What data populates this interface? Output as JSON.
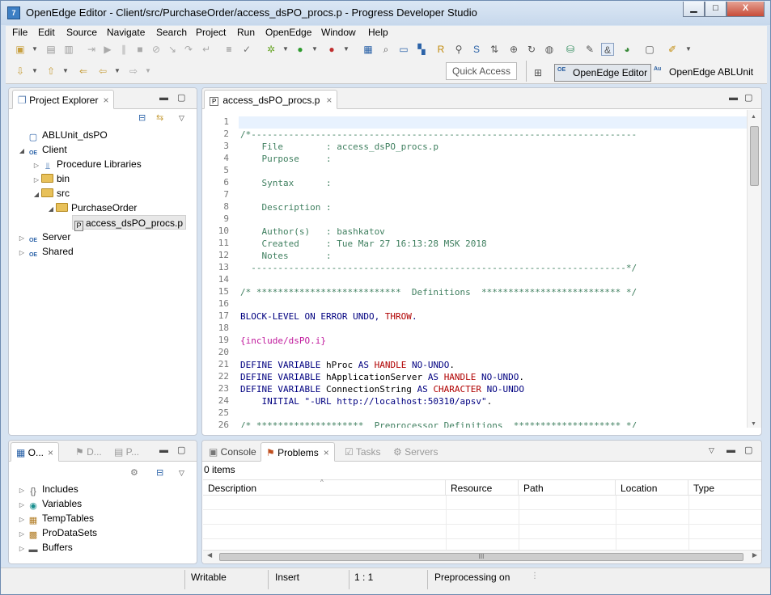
{
  "window": {
    "title": "OpenEdge Editor - Client/src/PurchaseOrder/access_dsPO_procs.p - Progress Developer Studio",
    "app_icon_text": "7",
    "minimize_label": "▁",
    "maximize_label": "□",
    "close_label": "X"
  },
  "menu": [
    "File",
    "Edit",
    "Source",
    "Navigate",
    "Search",
    "Project",
    "Run",
    "OpenEdge",
    "Window",
    "Help"
  ],
  "toolbar": {
    "quick_access_placeholder": "Quick Access",
    "perspectives": [
      {
        "label": "OpenEdge Editor",
        "icon_text": "OE",
        "active": true
      },
      {
        "label": "OpenEdge ABLUnit",
        "icon_text": "Au",
        "active": false
      }
    ]
  },
  "project_explorer": {
    "tab_label": "Project Explorer",
    "tree": [
      {
        "label": "ABLUnit_dsPO",
        "icon": "project-icon",
        "expanded": null
      },
      {
        "label": "Client",
        "icon": "oe-project-icon",
        "expanded": true
      },
      {
        "label": "Procedure Libraries",
        "icon": "library-icon",
        "expanded": false
      },
      {
        "label": "bin",
        "icon": "folder-icon",
        "expanded": false
      },
      {
        "label": "src",
        "icon": "folder-icon",
        "expanded": true
      },
      {
        "label": "PurchaseOrder",
        "icon": "folder-icon",
        "expanded": true
      },
      {
        "label": "access_dsPO_procs.p",
        "icon": "procedure-file-icon",
        "expanded": null
      },
      {
        "label": "Server",
        "icon": "oe-project-icon",
        "expanded": false
      },
      {
        "label": "Shared",
        "icon": "oe-project-icon",
        "expanded": false
      }
    ]
  },
  "editor": {
    "tab_label": "access_dsPO_procs.p",
    "tab_icon_text": "P",
    "lines": [
      {
        "n": "1",
        "parts": []
      },
      {
        "n": "2",
        "parts": [
          {
            "t": "/*------------------------------------------------------------------------",
            "c": "cmt"
          }
        ]
      },
      {
        "n": "3",
        "parts": [
          {
            "t": "    File        : access_dsPO_procs.p",
            "c": "cmt"
          }
        ]
      },
      {
        "n": "4",
        "parts": [
          {
            "t": "    Purpose     :",
            "c": "cmt"
          }
        ]
      },
      {
        "n": "5",
        "parts": []
      },
      {
        "n": "6",
        "parts": [
          {
            "t": "    Syntax      :",
            "c": "cmt"
          }
        ]
      },
      {
        "n": "7",
        "parts": []
      },
      {
        "n": "8",
        "parts": [
          {
            "t": "    Description :",
            "c": "cmt"
          }
        ]
      },
      {
        "n": "9",
        "parts": []
      },
      {
        "n": "10",
        "parts": [
          {
            "t": "    Author(s)   : bashkatov",
            "c": "cmt"
          }
        ]
      },
      {
        "n": "11",
        "parts": [
          {
            "t": "    Created     : Tue Mar 27 16:13:28 MSK 2018",
            "c": "cmt"
          }
        ]
      },
      {
        "n": "12",
        "parts": [
          {
            "t": "    Notes       :",
            "c": "cmt"
          }
        ]
      },
      {
        "n": "13",
        "parts": [
          {
            "t": "  ----------------------------------------------------------------------*/",
            "c": "cmt"
          }
        ]
      },
      {
        "n": "14",
        "parts": []
      },
      {
        "n": "15",
        "parts": [
          {
            "t": "/* ***************************  Definitions  ************************** */",
            "c": "cmt"
          }
        ]
      },
      {
        "n": "16",
        "parts": []
      },
      {
        "n": "17",
        "parts": [
          {
            "t": "BLOCK-LEVEL ON ERROR UNDO, ",
            "c": "kw"
          },
          {
            "t": "THROW",
            "c": "red"
          },
          {
            "t": ".",
            "c": "kw"
          }
        ]
      },
      {
        "n": "18",
        "parts": []
      },
      {
        "n": "19",
        "parts": [
          {
            "t": "{include/dsPO.i}",
            "c": "pp"
          }
        ]
      },
      {
        "n": "20",
        "parts": []
      },
      {
        "n": "21",
        "parts": [
          {
            "t": "DEFINE VARIABLE ",
            "c": "kw"
          },
          {
            "t": "hProc ",
            "c": ""
          },
          {
            "t": "AS ",
            "c": "kw"
          },
          {
            "t": "HANDLE ",
            "c": "red"
          },
          {
            "t": "NO-UNDO",
            "c": "kw"
          },
          {
            "t": ".",
            "c": ""
          }
        ]
      },
      {
        "n": "22",
        "parts": [
          {
            "t": "DEFINE VARIABLE ",
            "c": "kw"
          },
          {
            "t": "hApplicationServer ",
            "c": ""
          },
          {
            "t": "AS ",
            "c": "kw"
          },
          {
            "t": "HANDLE ",
            "c": "red"
          },
          {
            "t": "NO-UNDO",
            "c": "kw"
          },
          {
            "t": ".",
            "c": ""
          }
        ]
      },
      {
        "n": "23",
        "parts": [
          {
            "t": "DEFINE VARIABLE ",
            "c": "kw"
          },
          {
            "t": "ConnectionString ",
            "c": ""
          },
          {
            "t": "AS ",
            "c": "kw"
          },
          {
            "t": "CHARACTER ",
            "c": "red"
          },
          {
            "t": "NO-UNDO",
            "c": "kw"
          }
        ]
      },
      {
        "n": "24",
        "parts": [
          {
            "t": "    INITIAL ",
            "c": "kw"
          },
          {
            "t": "\"-URL http://localhost:50310/apsv\"",
            "c": "str"
          },
          {
            "t": ".",
            "c": ""
          }
        ]
      },
      {
        "n": "25",
        "parts": []
      },
      {
        "n": "26",
        "parts": [
          {
            "t": "/* ********************  Preprocessor Definitions  ******************** */",
            "c": "cmt"
          }
        ]
      }
    ]
  },
  "outline_panel": {
    "tabs": [
      "O...",
      "D...",
      "P..."
    ],
    "items": [
      {
        "label": "Includes",
        "icon": "includes-icon"
      },
      {
        "label": "Variables",
        "icon": "variables-icon"
      },
      {
        "label": "TempTables",
        "icon": "temptables-icon"
      },
      {
        "label": "ProDataSets",
        "icon": "prodatasets-icon"
      },
      {
        "label": "Buffers",
        "icon": "buffers-icon"
      }
    ]
  },
  "bottom_panel": {
    "tabs": [
      {
        "label": "Console",
        "active": false
      },
      {
        "label": "Problems",
        "active": true
      },
      {
        "label": "Tasks",
        "active": false
      },
      {
        "label": "Servers",
        "active": false
      }
    ],
    "item_count": "0 items",
    "columns": [
      "Description",
      "Resource",
      "Path",
      "Location",
      "Type"
    ],
    "scroll_grip": "III"
  },
  "statusbar": {
    "mode": "Writable",
    "insert": "Insert",
    "position": "1 : 1",
    "task": "Preprocessing on"
  },
  "colors": {
    "comment": "#3f7f5f",
    "keyword": "#000080",
    "type_keyword": "#b00000",
    "preprocessor": "#c0189c",
    "window_frame": "#d7e3f1"
  }
}
